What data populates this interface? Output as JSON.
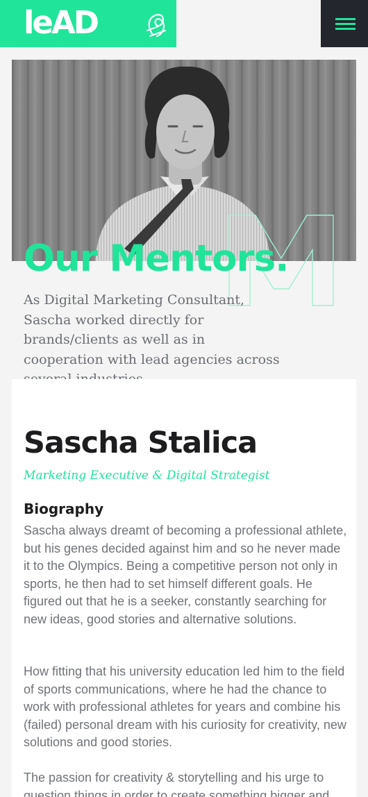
{
  "header": {
    "logo_text": "leAD",
    "logo_mark_icon": "lead-signature-icon",
    "menu_icon": "hamburger-menu-icon",
    "brand_color": "#20e49a",
    "menu_bg_color": "#23262d"
  },
  "hero": {
    "photo": "mentor-portrait-photo",
    "title": "Our Mentors.",
    "decorative_letter": "M",
    "description": "As Digital Marketing Consultant, Sascha worked directly for brands/clients as well as in cooperation with lead agencies across several industries."
  },
  "mentor": {
    "name": "Sascha Stalica",
    "role": "Marketing Executive & Digital Strategist",
    "bio_heading": "Biography",
    "bio_paragraphs": [
      "Sascha always dreamt of becoming a professional athlete, but his genes decided against him and so he never made it to the Olympics. Being a competitive person not only in sports, he then had to set himself different goals. He figured out that he is a seeker, constantly searching for new ideas, good stories and alternative solutions.",
      "How fitting that his university education led him to the field of sports communications, where he had the chance to work with professional athletes for years and combine his (failed) personal dream with his curiosity for creativity, new solutions and good stories.",
      "The passion for creativity & storytelling and his urge to question things in order to create something bigger and"
    ]
  }
}
